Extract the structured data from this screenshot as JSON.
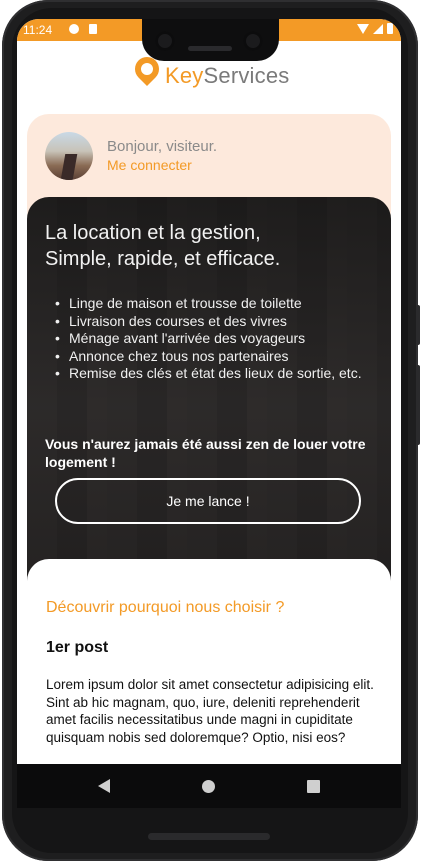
{
  "status_bar": {
    "time": "11:24",
    "icons": [
      "notification-icon",
      "sd-card-icon",
      "wifi-icon",
      "signal-icon",
      "battery-icon"
    ],
    "color": "#f39a26"
  },
  "header": {
    "brand_part1": "Key",
    "brand_part2": "Services",
    "accent": "#f39a26"
  },
  "user": {
    "greeting": "Bonjour, visiteur.",
    "login_label": "Me connecter"
  },
  "hero": {
    "title_line1": "La location et la gestion,",
    "title_line2": "Simple, rapide, et efficace.",
    "features": [
      "Linge de maison et trousse de toilette",
      "Livraison des courses et des vivres",
      "Ménage avant l'arrivée des voyageurs",
      "Annonce chez tous nos partenaires",
      "Remise des clés et état des lieux de sortie, etc."
    ],
    "tagline": "Vous n'aurez jamais été aussi zen de louer votre logement !",
    "cta_label": "Je me lance !"
  },
  "content": {
    "section_title": "Découvrir pourquoi nous choisir ?",
    "post_title": "1er post",
    "post_body": "Lorem ipsum dolor sit amet consectetur adipisicing elit. Sint ab hic magnam, quo, iure, deleniti reprehenderit amet facilis necessitatibus unde magni in cupiditate quisquam nobis sed doloremque? Optio, nisi eos?"
  },
  "nav_bar": {
    "icons": [
      "back-icon",
      "home-icon",
      "recent-apps-icon"
    ]
  }
}
